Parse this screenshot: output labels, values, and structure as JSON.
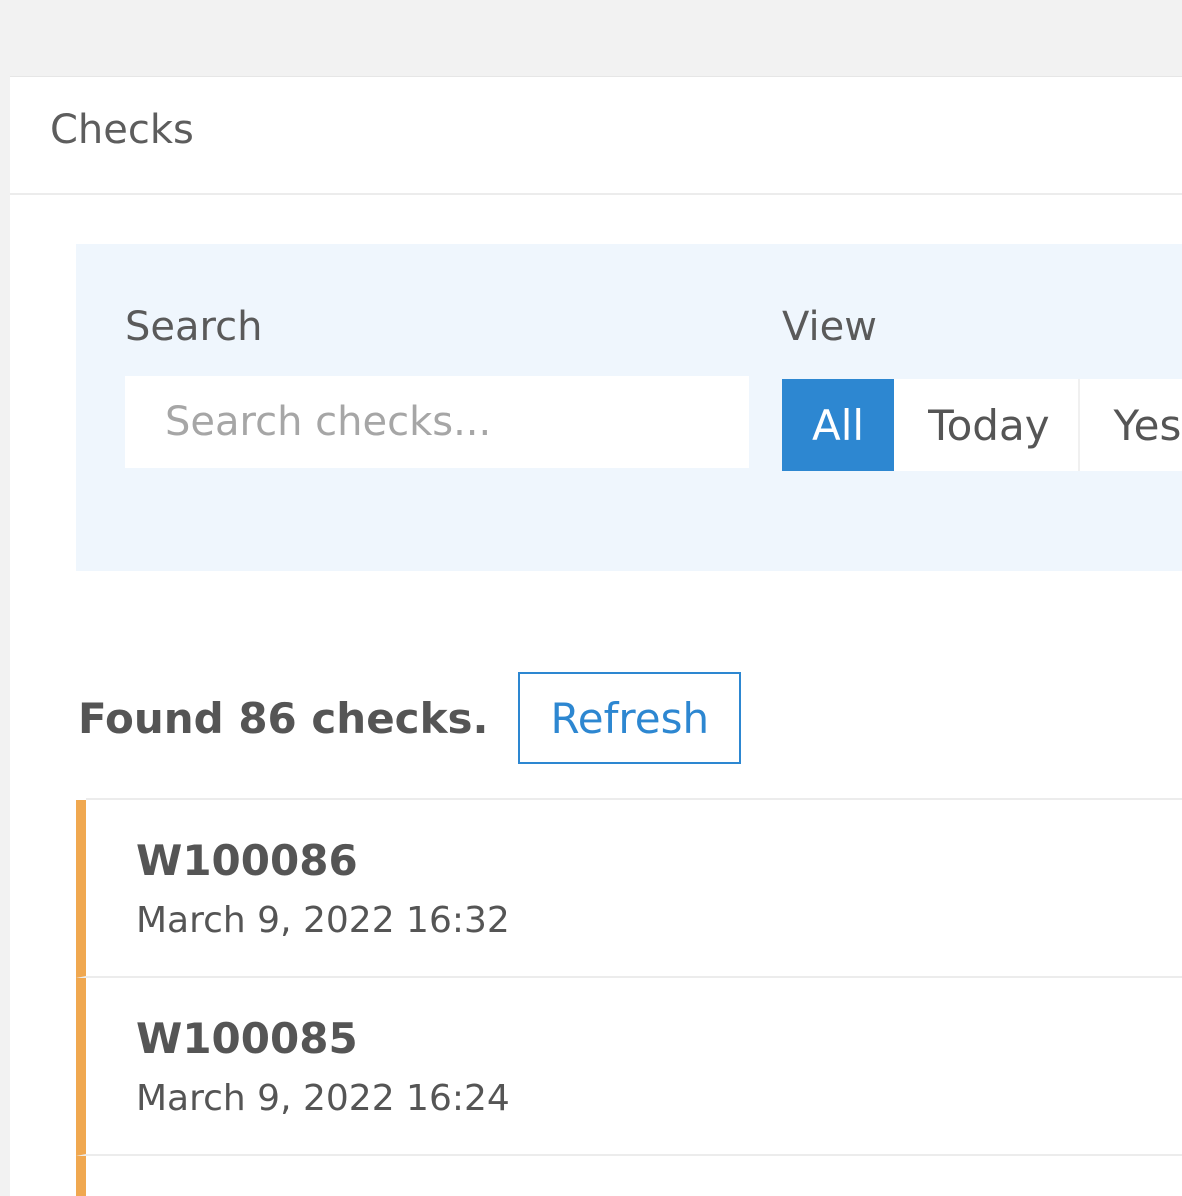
{
  "header": {
    "title": "Checks"
  },
  "filters": {
    "search_label": "Search",
    "search_placeholder": "Search checks...",
    "search_value": "",
    "view_label": "View",
    "view_options": [
      "All",
      "Today",
      "Yes"
    ],
    "view_selected": "All"
  },
  "results": {
    "found_text": "Found 86 checks.",
    "refresh_label": "Refresh"
  },
  "checks": [
    {
      "id": "W100086",
      "date": "March 9, 2022 16:32"
    },
    {
      "id": "W100085",
      "date": "March 9, 2022 16:24"
    }
  ],
  "colors": {
    "accent": "#2d87d1",
    "item_marker": "#f0a850",
    "filter_background": "#eff6fd"
  }
}
